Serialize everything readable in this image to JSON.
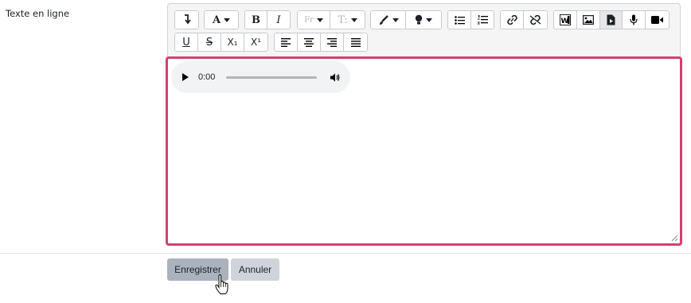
{
  "form": {
    "field_label": "Texte en ligne"
  },
  "toolbar": {
    "row1_groups": [
      [
        "collapse-icon"
      ],
      [
        "font-color-a-icon"
      ],
      [
        "bold-icon",
        "italic-icon"
      ],
      [
        "font-family-icon",
        "font-size-icon"
      ],
      [
        "text-color-brush-icon",
        "background-color-icon"
      ],
      [
        "bullet-list-icon",
        "numbered-list-icon"
      ],
      [
        "link-icon",
        "unlink-icon"
      ],
      [
        "word-import-icon",
        "image-icon",
        "media-icon",
        "record-audio-icon",
        "record-video-icon"
      ]
    ],
    "row2_groups": [
      [
        "underline-icon",
        "strikethrough-icon",
        "subscript-icon",
        "superscript-icon"
      ],
      [
        "align-left-icon",
        "align-center-icon",
        "align-right-icon",
        "justify-icon"
      ]
    ],
    "labels": {
      "bold": "B",
      "italic": "I",
      "subscript": "X₁",
      "superscript": "X¹",
      "font_color": "A",
      "font_family": "Fr",
      "font_size": "T:"
    }
  },
  "audio_player": {
    "time": "0:00",
    "progress": 0
  },
  "actions": {
    "save_label": "Enregistrer",
    "cancel_label": "Annuler"
  },
  "colors": {
    "focus_border": "#d1416e",
    "save_bg": "#aab3bd",
    "cancel_bg": "#cfd4da"
  }
}
